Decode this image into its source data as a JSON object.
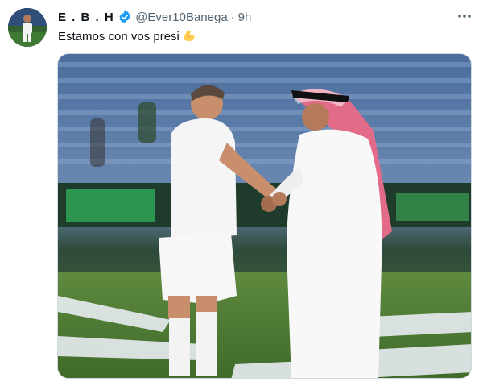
{
  "tweet": {
    "display_name": "E . B . H",
    "handle": "@Ever10Banega",
    "separator": "·",
    "time": "9h",
    "text": "Estamos con vos presi",
    "emoji": "flexed-biceps-icon",
    "verified_icon": "verified-badge-icon",
    "more_icon": "more-options-icon"
  },
  "colors": {
    "verified": "#1d9bf0",
    "secondary_text": "#536471",
    "primary_text": "#0f1419"
  }
}
